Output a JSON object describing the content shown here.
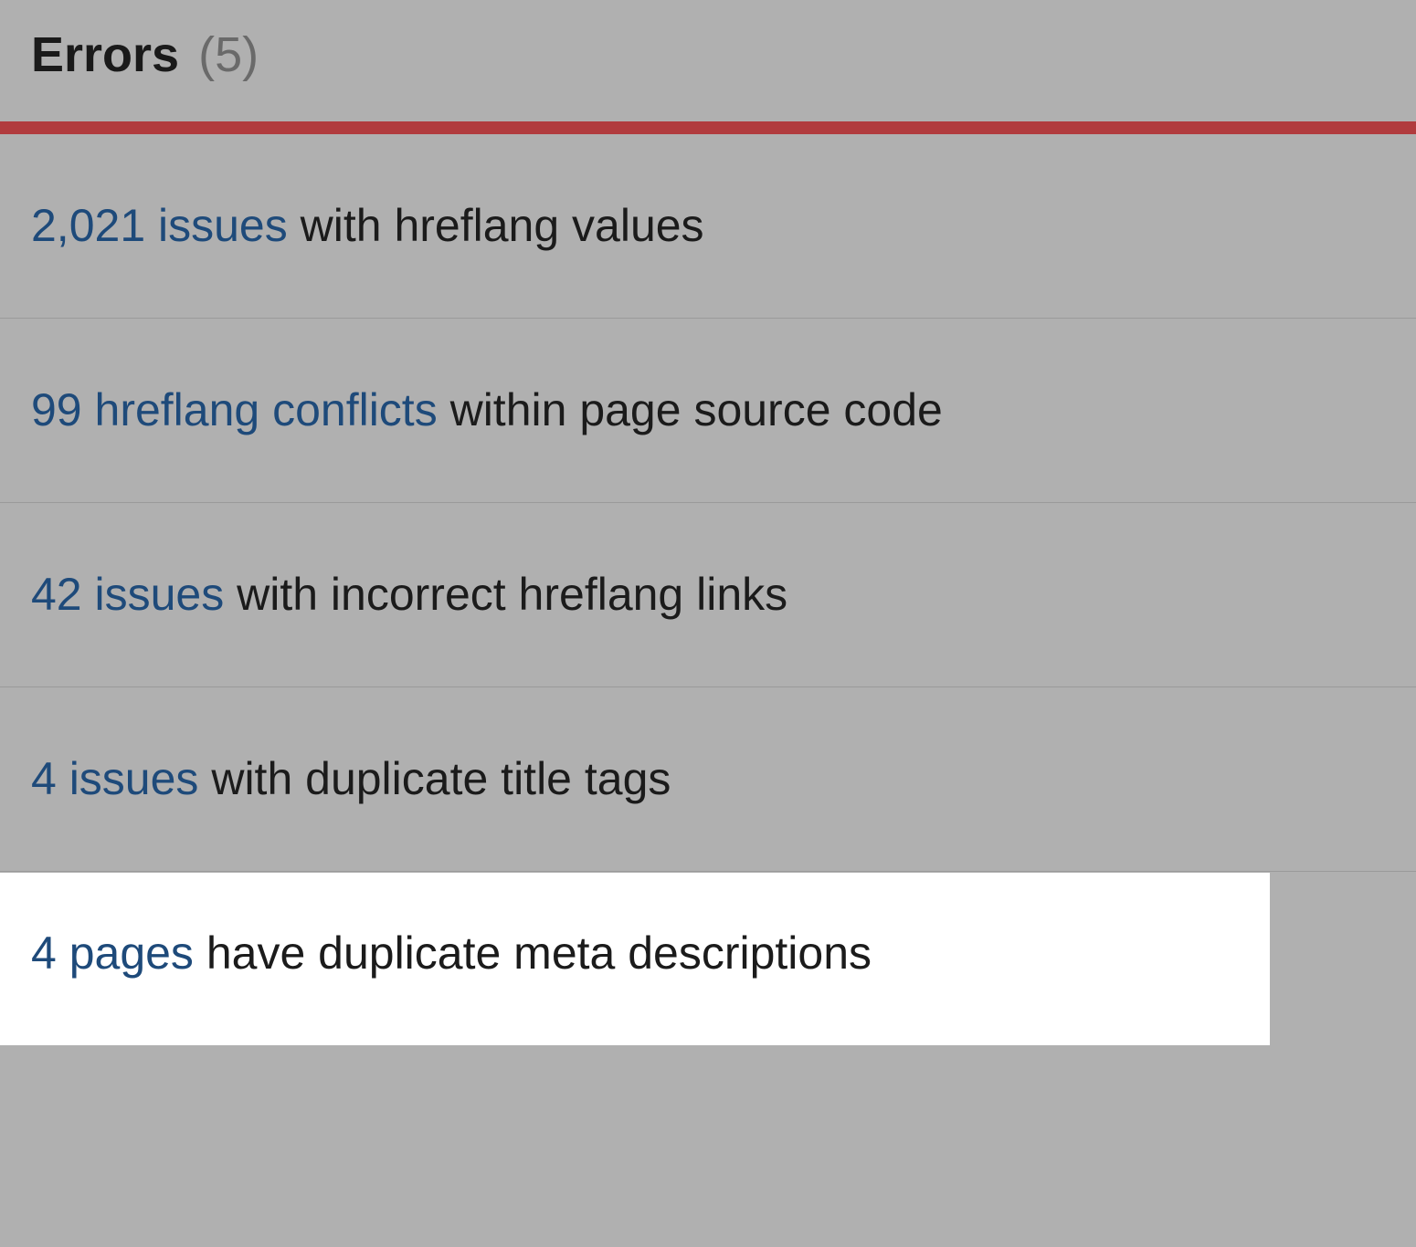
{
  "header": {
    "title": "Errors",
    "count": "(5)"
  },
  "errors": [
    {
      "link": "2,021 issues",
      "text": " with hreflang values"
    },
    {
      "link": "99 hreflang conflicts",
      "text": " within page source code"
    },
    {
      "link": "42 issues",
      "text": " with incorrect hreflang links"
    },
    {
      "link": "4 issues",
      "text": " with duplicate title tags"
    },
    {
      "link": "4 pages",
      "text": " have duplicate meta descriptions"
    }
  ],
  "colors": {
    "linkColor": "#1e4a7a",
    "background": "#b0b0b0",
    "dividerRed": "#b13b3e",
    "highlight": "#ffffff"
  }
}
